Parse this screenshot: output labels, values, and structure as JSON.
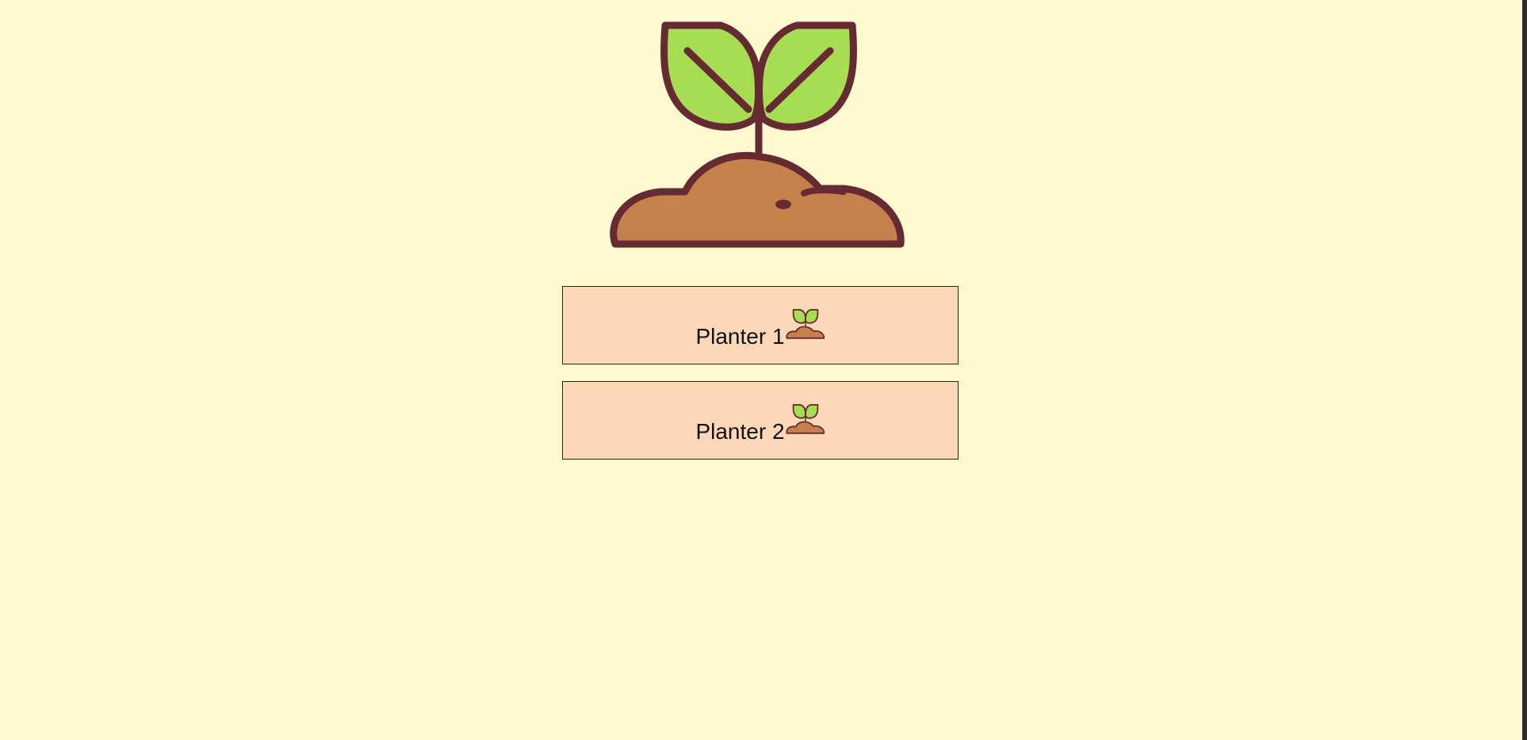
{
  "logo": {
    "icon": "sprout-in-soil-icon"
  },
  "planters": [
    {
      "label": "Planter 1",
      "icon": "sprout-in-soil-icon"
    },
    {
      "label": "Planter 2",
      "icon": "sprout-in-soil-icon"
    }
  ],
  "colors": {
    "background": "#fef9cf",
    "button": "#fdd8b8",
    "leaf": "#a6dd52",
    "soil": "#c4814b",
    "outline": "#662a33"
  }
}
